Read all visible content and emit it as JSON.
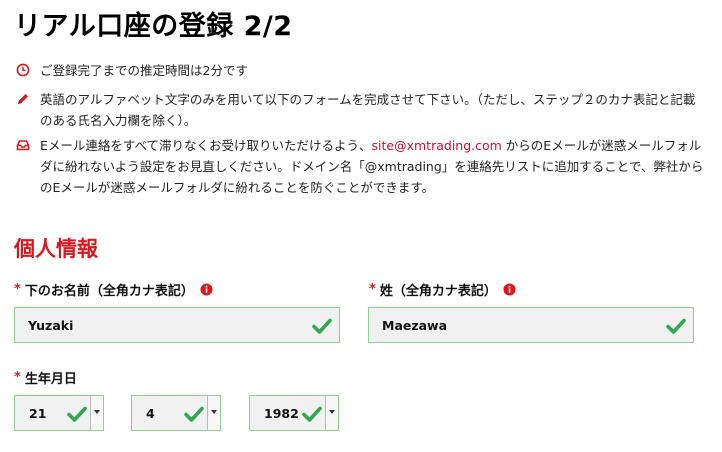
{
  "page": {
    "title": "リアル口座の登録 2/2"
  },
  "notes": {
    "time": "ご登録完了までの推定時間は2分です",
    "english": "英語のアルファベット文字のみを用いて以下のフォームを完成させて下さい。（ただし、ステップ２のカナ表記と記載のある氏名入力欄を除く）。",
    "email_pre": "Eメール連絡をすべて滞りなくお受け取りいただけるよう、",
    "email_link": "site@xmtrading.com",
    "email_post": " からのEメールが迷惑メールフォルダに紛れないよう設定をお見直しください。ドメイン名「@xmtrading」を連絡先リストに追加することで、弊社からのEメールが迷惑メールフォルダに紛れることを防ぐことができます。"
  },
  "section": {
    "title": "個人情報"
  },
  "form": {
    "required_mark": "*",
    "first_name": {
      "label": "下のお名前（全角カナ表記）",
      "value": "Yuzaki"
    },
    "last_name": {
      "label": "姓（全角カナ表記）",
      "value": "Maezawa"
    },
    "birth": {
      "label": "生年月日",
      "day": "21",
      "month": "4",
      "year": "1982"
    }
  },
  "colors": {
    "accent": "#d71920",
    "valid": "#2fa84f",
    "valid_border": "#8fcf8f"
  },
  "icons": {
    "time": "clock-icon",
    "english": "pencil-icon",
    "email": "inbox-icon",
    "info": "info-icon",
    "valid": "checkmark-icon"
  }
}
